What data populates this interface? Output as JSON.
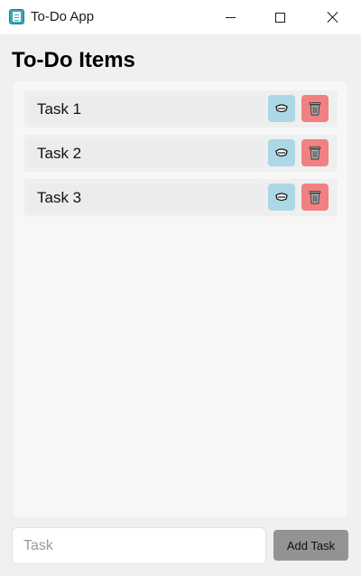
{
  "window": {
    "title": "To-Do App",
    "icon": "notepad-icon",
    "controls": [
      "minimize-icon",
      "maximize-icon",
      "close-icon"
    ]
  },
  "heading": "To-Do Items",
  "tasks": [
    {
      "label": "Task 1",
      "edit_icon": "edit-icon",
      "delete_icon": "trash-icon"
    },
    {
      "label": "Task 2",
      "edit_icon": "edit-icon",
      "delete_icon": "trash-icon"
    },
    {
      "label": "Task 3",
      "edit_icon": "edit-icon",
      "delete_icon": "trash-icon"
    }
  ],
  "input": {
    "placeholder": "Task",
    "value": ""
  },
  "add_button_label": "Add Task",
  "colors": {
    "edit_button": "#acd8e6",
    "delete_button": "#f08081",
    "add_button": "#939393",
    "panel": "#f7f7f7",
    "background": "#f0f0f0"
  }
}
